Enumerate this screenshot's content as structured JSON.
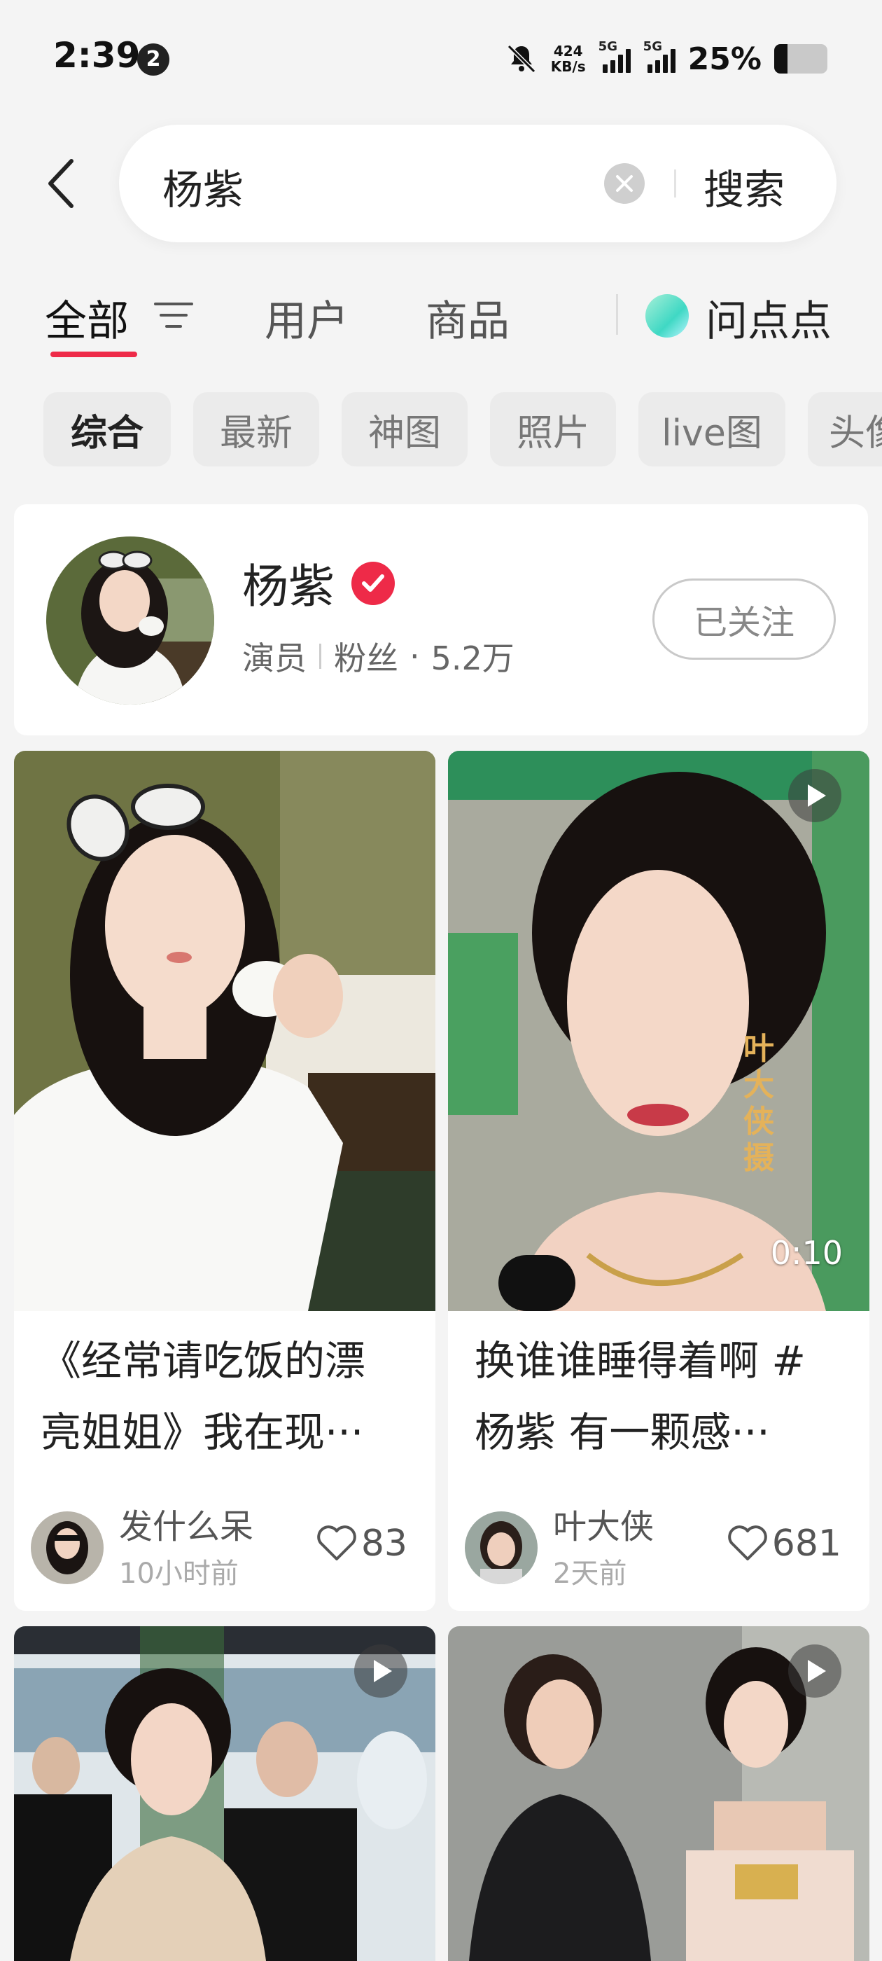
{
  "status_bar": {
    "time": "2:39",
    "notif_count": "2",
    "speed_top": "424",
    "speed_unit": "KB/s",
    "net1": "5G",
    "net2": "5G",
    "battery_pct": "25%",
    "battery_level": 0.25
  },
  "search": {
    "query": "杨紫",
    "submit_label": "搜索"
  },
  "tabs": [
    {
      "label": "全部"
    },
    {
      "label": "用户"
    },
    {
      "label": "商品"
    },
    {
      "label": "问点点"
    }
  ],
  "chips": [
    "综合",
    "最新",
    "神图",
    "照片",
    "live图",
    "头像"
  ],
  "user_card": {
    "name": "杨紫",
    "role": "演员",
    "fans_label": "粉丝",
    "fans_sep": "·",
    "fans_count": "5.2万",
    "follow_label": "已关注"
  },
  "posts": [
    {
      "title_line1": "《经常请吃饭的漂",
      "title_line2": "亮姐姐》我在现···",
      "author": "发什么呆",
      "time": "10小时前",
      "likes": "83",
      "is_video": false
    },
    {
      "title_line1": "换谁谁睡得着啊 #",
      "title_line2": "杨紫 有一颗感···",
      "author": "叶大侠",
      "time": "2天前",
      "likes": "681",
      "is_video": true,
      "duration": "0:10",
      "watermark": "叶大侠摄"
    },
    {
      "is_video": true
    },
    {
      "is_video": true
    }
  ],
  "colors": {
    "accent": "#ee2a48",
    "background": "#f4f4f4",
    "card": "#ffffff",
    "ai_gradient": "#3fd8c4"
  }
}
